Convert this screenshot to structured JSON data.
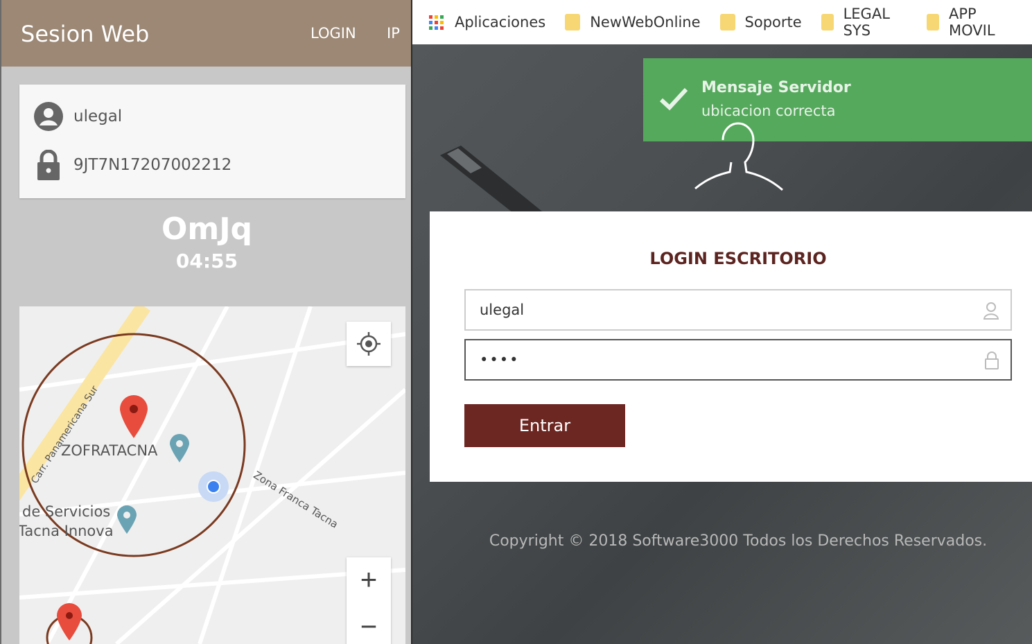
{
  "mobile": {
    "app_title": "Sesion Web",
    "tabs": [
      "LOGIN",
      "IP"
    ],
    "user": "ulegal",
    "device_code": "9JT7N17207002212",
    "token_code": "OmJq",
    "token_timer": "04:55",
    "map": {
      "road_label": "Carr. Panamericana Sur",
      "place_label": "ZOFRATACNA",
      "zone_label": "Zona Franca Tacna",
      "poi_line1": "de Servicios",
      "poi_line2": "Tacna Innova",
      "zoom_in": "+",
      "zoom_out": "−"
    }
  },
  "desktop": {
    "bookmarks": [
      "Aplicaciones",
      "NewWebOnline",
      "Soporte",
      "LEGAL SYS",
      "APP MOVIL"
    ],
    "toast": {
      "title": "Mensaje Servidor",
      "message": "ubicacion correcta",
      "color": "#55a95c"
    },
    "login": {
      "title": "LOGIN ESCRITORIO",
      "username_value": "ulegal",
      "password_mask": "••••",
      "submit_label": "Entrar",
      "accent": "#6d2723"
    },
    "copyright": "Copyright © 2018 Software3000 Todos los Derechos Reservados."
  }
}
